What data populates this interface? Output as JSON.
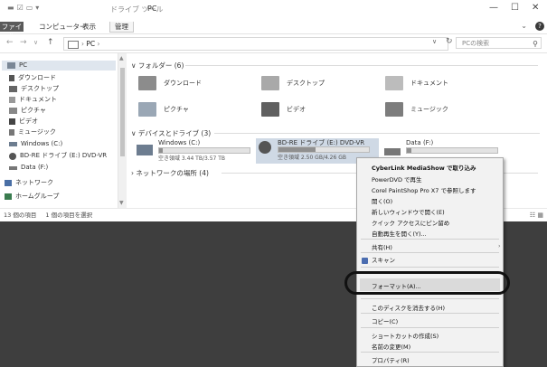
{
  "window": {
    "tool_title": "ドライブ ツール",
    "title": "PC",
    "minimize": "—",
    "maximize": "☐",
    "close": "✕"
  },
  "ribbon": {
    "tabs": [
      "ファイル",
      "コンピューター",
      "表示",
      "管理"
    ],
    "expand": "⌄",
    "help": "?"
  },
  "address": {
    "path": "PC",
    "search_placeholder": "PCの検索"
  },
  "nav": {
    "items": [
      {
        "label": "PC",
        "icon": "computer-icon"
      },
      {
        "label": "ダウンロード",
        "icon": "download-icon"
      },
      {
        "label": "デスクトップ",
        "icon": "desktop-icon"
      },
      {
        "label": "ドキュメント",
        "icon": "document-icon"
      },
      {
        "label": "ピクチャ",
        "icon": "picture-icon"
      },
      {
        "label": "ビデオ",
        "icon": "video-icon"
      },
      {
        "label": "ミュージック",
        "icon": "music-icon"
      },
      {
        "label": "Windows (C:)",
        "icon": "drive-icon"
      },
      {
        "label": "BD-RE ドライブ (E:) DVD-VR",
        "icon": "disc-icon"
      },
      {
        "label": "Data (F:)",
        "icon": "drive-icon"
      },
      {
        "label": "ネットワーク",
        "icon": "network-icon"
      },
      {
        "label": "ホームグループ",
        "icon": "homegroup-icon"
      }
    ]
  },
  "content": {
    "folders_header": "フォルダー (6)",
    "folders": [
      "ダウンロード",
      "デスクトップ",
      "ドキュメント",
      "ピクチャ",
      "ビデオ",
      "ミュージック"
    ],
    "drives_header": "デバイスとドライブ (3)",
    "drives": [
      {
        "name": "Windows (C:)",
        "free": "空き領域 3.44 TB/3.57 TB",
        "used_fraction": 0.04
      },
      {
        "name": "BD-RE ドライブ (E:) DVD-VR",
        "free": "空き領域 2.50 GB/4.26 GB",
        "used_fraction": 0.41
      },
      {
        "name": "Data (F:)",
        "free": "",
        "used_fraction": 0.05
      }
    ],
    "network_header": "ネットワークの場所 (4)"
  },
  "status": {
    "count": "13 個の項目",
    "selected": "1 個の項目を選択"
  },
  "context_menu": {
    "items": [
      "CyberLink MediaShow で取り込み",
      "PowerDVD で再生",
      "Corel PaintShop Pro X7 で参照します",
      "開く(O)",
      "新しいウィンドウで開く(E)",
      "クイック アクセスにピン留め",
      "自動再生を開く(Y)...",
      "共有(H)",
      "スキャン",
      "フォーマット(A)...",
      "このディスクを消去する(H)",
      "コピー(C)",
      "ショートカットの作成(S)",
      "名前の変更(M)",
      "プロパティ(R)"
    ]
  }
}
